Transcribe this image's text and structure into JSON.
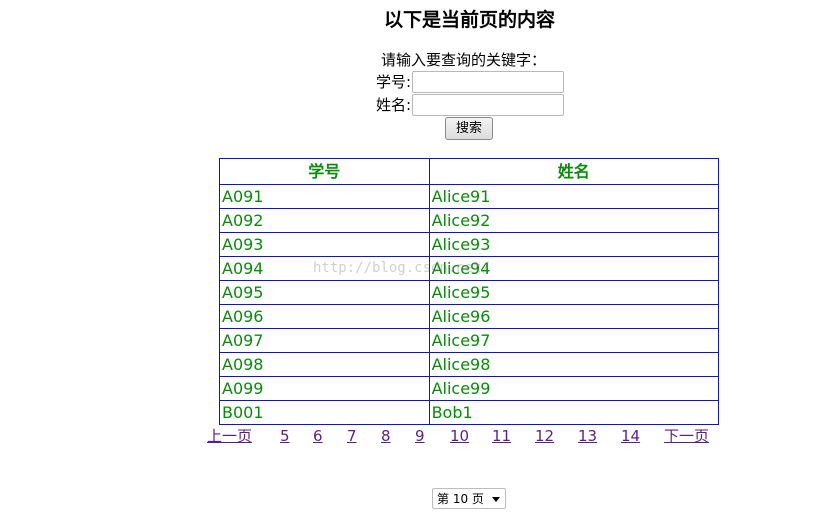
{
  "page": {
    "title": "以下是当前页的内容"
  },
  "search": {
    "prompt": "请输入要查询的关键字：",
    "id_label": "学号:",
    "id_value": "",
    "name_label": "姓名:",
    "name_value": "",
    "button_label": "搜索"
  },
  "table": {
    "headers": [
      "学号",
      "姓名"
    ],
    "rows": [
      [
        "A091",
        "Alice91"
      ],
      [
        "A092",
        "Alice92"
      ],
      [
        "A093",
        "Alice93"
      ],
      [
        "A094",
        "Alice94"
      ],
      [
        "A095",
        "Alice95"
      ],
      [
        "A096",
        "Alice96"
      ],
      [
        "A097",
        "Alice97"
      ],
      [
        "A098",
        "Alice98"
      ],
      [
        "A099",
        "Alice99"
      ],
      [
        "B001",
        "Bob1"
      ]
    ],
    "header_color": "#0b8a0b",
    "border_color": "#1212c8"
  },
  "watermark": "http://blog.csdn.net/",
  "pagination": {
    "prev_label": "上一页",
    "pages": [
      "5",
      "6",
      "7",
      "8",
      "9",
      "10",
      "11",
      "12",
      "13",
      "14"
    ],
    "current": "10",
    "next_label": "下一页",
    "link_color": "#5a1e8c"
  },
  "page_select": {
    "selected": "第 10 页"
  }
}
